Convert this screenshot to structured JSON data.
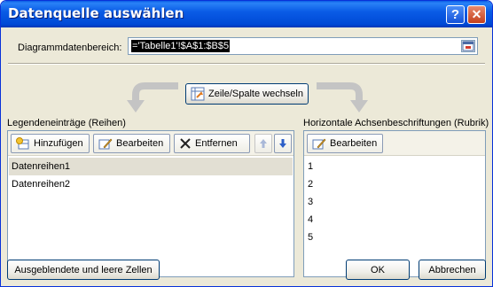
{
  "window": {
    "title": "Datenquelle auswählen",
    "help_label": "?",
    "close_label": "✕"
  },
  "range": {
    "label_prefix": "",
    "label": "Diagrammdatenbereich:",
    "value": "='Tabelle1'!$A$1:$B$5"
  },
  "switch_button": {
    "label": "Zeile/Spalte wechseln"
  },
  "legend": {
    "header": "Legendeneinträge (Reihen)",
    "add_label": "Hinzufügen",
    "edit_label": "Bearbeiten",
    "remove_label": "Entfernen",
    "items": [
      "Datenreihen1",
      "Datenreihen2"
    ],
    "selected_index": 0
  },
  "axis": {
    "header": "Horizontale Achsenbeschriftungen (Rubrik)",
    "edit_label": "Bearbeiten",
    "items": [
      "1",
      "2",
      "3",
      "4",
      "5"
    ]
  },
  "footer": {
    "hidden_cells_label": "Ausgeblendete und leere Zellen",
    "ok_label": "OK",
    "cancel_label": "Abbrechen"
  },
  "colors": {
    "titlebar": "#0a5ce6",
    "dialog_bg": "#ece9d8",
    "border_blue": "#003c74",
    "selection": "#e2dfd3"
  },
  "icons": {
    "collapse": "collapse-dialog-icon",
    "switch": "switch-row-column-icon",
    "add": "add-series-icon",
    "edit": "edit-pencil-icon",
    "remove": "remove-x-icon",
    "up": "move-up-arrow-icon",
    "down": "move-down-arrow-icon"
  }
}
